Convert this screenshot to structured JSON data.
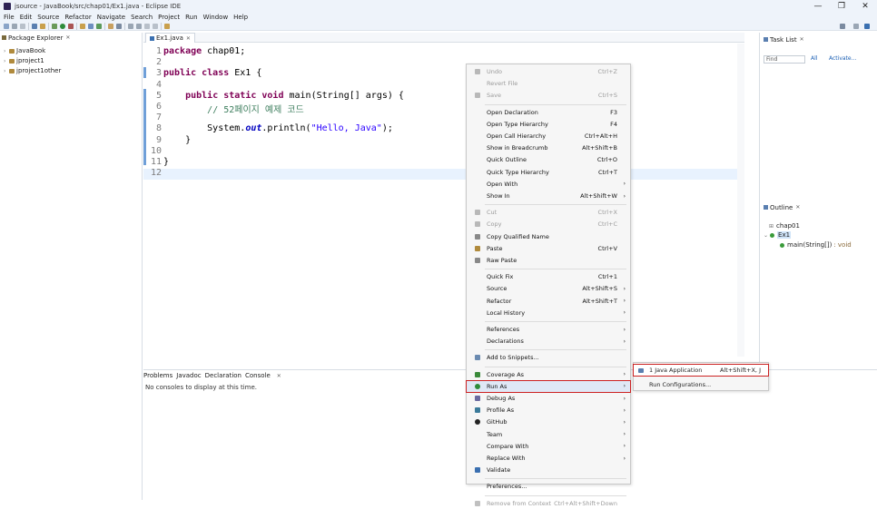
{
  "window": {
    "title": "jsource - JavaBook/src/chap01/Ex1.java - Eclipse IDE",
    "controls": [
      "—",
      "❐",
      "✕"
    ]
  },
  "menubar": [
    "File",
    "Edit",
    "Source",
    "Refactor",
    "Navigate",
    "Search",
    "Project",
    "Run",
    "Window",
    "Help"
  ],
  "package_explorer": {
    "tab": "Package Explorer",
    "projects": [
      "JavaBook",
      "jproject1",
      "jproject1other"
    ]
  },
  "editor": {
    "tab": "Ex1.java",
    "lines": [
      {
        "n": "1",
        "parts": [
          [
            "kw",
            "package"
          ],
          [
            "t",
            " chap01;"
          ]
        ]
      },
      {
        "n": "2",
        "parts": []
      },
      {
        "n": "3",
        "parts": [
          [
            "kw",
            "public class"
          ],
          [
            "t",
            " Ex1 {"
          ]
        ]
      },
      {
        "n": "4",
        "parts": []
      },
      {
        "n": "5",
        "parts": [
          [
            "t",
            "    "
          ],
          [
            "kw",
            "public static void"
          ],
          [
            "t",
            " main(String[] args) {"
          ]
        ]
      },
      {
        "n": "6",
        "parts": [
          [
            "t",
            "        "
          ],
          [
            "cmt",
            "// 52페이지 예제 코드"
          ]
        ]
      },
      {
        "n": "7",
        "parts": []
      },
      {
        "n": "8",
        "parts": [
          [
            "t",
            "        System."
          ],
          [
            "fld",
            "out"
          ],
          [
            "t",
            ".println("
          ],
          [
            "str",
            "\"Hello, Java\""
          ],
          [
            "t",
            ");"
          ]
        ]
      },
      {
        "n": "9",
        "parts": [
          [
            "t",
            "    }"
          ]
        ]
      },
      {
        "n": "10",
        "parts": []
      },
      {
        "n": "11",
        "parts": [
          [
            "t",
            "}"
          ]
        ]
      },
      {
        "n": "12",
        "parts": []
      }
    ]
  },
  "bottom_panel": {
    "tabs": [
      "Problems",
      "Javadoc",
      "Declaration",
      "Console"
    ],
    "message": "No consoles to display at this time."
  },
  "task_list": {
    "tab": "Task List",
    "find_placeholder": "Find",
    "all_label": "All",
    "activate_label": "Activate..."
  },
  "outline": {
    "tab": "Outline",
    "items": [
      "chap01",
      "Ex1",
      "main(String[])",
      ": void"
    ]
  },
  "context_menu": {
    "items": [
      {
        "label": "Undo",
        "accel": "Ctrl+Z",
        "disabled": true,
        "icon": "undo-icon"
      },
      {
        "label": "Revert File",
        "accel": "",
        "disabled": true
      },
      {
        "label": "Save",
        "accel": "Ctrl+S",
        "disabled": true,
        "icon": "save-icon"
      },
      {
        "sep": true
      },
      {
        "label": "Open Declaration",
        "accel": "F3"
      },
      {
        "label": "Open Type Hierarchy",
        "accel": "F4"
      },
      {
        "label": "Open Call Hierarchy",
        "accel": "Ctrl+Alt+H"
      },
      {
        "label": "Show in Breadcrumb",
        "accel": "Alt+Shift+B"
      },
      {
        "label": "Quick Outline",
        "accel": "Ctrl+O"
      },
      {
        "label": "Quick Type Hierarchy",
        "accel": "Ctrl+T"
      },
      {
        "label": "Open With",
        "accel": "",
        "submenu": true
      },
      {
        "label": "Show In",
        "accel": "Alt+Shift+W",
        "submenu": true
      },
      {
        "sep": true
      },
      {
        "label": "Cut",
        "accel": "Ctrl+X",
        "disabled": true,
        "icon": "cut-icon"
      },
      {
        "label": "Copy",
        "accel": "Ctrl+C",
        "disabled": true,
        "icon": "copy-icon"
      },
      {
        "label": "Copy Qualified Name",
        "accel": "",
        "icon": "copy-qualified-icon"
      },
      {
        "label": "Paste",
        "accel": "Ctrl+V",
        "icon": "paste-icon"
      },
      {
        "label": "Raw Paste",
        "accel": "",
        "icon": "raw-paste-icon"
      },
      {
        "sep": true
      },
      {
        "label": "Quick Fix",
        "accel": "Ctrl+1"
      },
      {
        "label": "Source",
        "accel": "Alt+Shift+S",
        "submenu": true
      },
      {
        "label": "Refactor",
        "accel": "Alt+Shift+T",
        "submenu": true
      },
      {
        "label": "Local History",
        "accel": "",
        "submenu": true
      },
      {
        "sep": true
      },
      {
        "label": "References",
        "accel": "",
        "submenu": true
      },
      {
        "label": "Declarations",
        "accel": "",
        "submenu": true
      },
      {
        "sep": true
      },
      {
        "label": "Add to Snippets...",
        "accel": "",
        "icon": "snippets-icon"
      },
      {
        "sep": true
      },
      {
        "label": "Coverage As",
        "accel": "",
        "submenu": true,
        "icon": "coverage-icon"
      },
      {
        "label": "Run As",
        "accel": "",
        "submenu": true,
        "icon": "run-icon",
        "selected": true
      },
      {
        "label": "Debug As",
        "accel": "",
        "submenu": true,
        "icon": "debug-icon"
      },
      {
        "label": "Profile As",
        "accel": "",
        "submenu": true,
        "icon": "profile-icon"
      },
      {
        "label": "GitHub",
        "accel": "",
        "submenu": true,
        "icon": "github-icon"
      },
      {
        "label": "Team",
        "accel": "",
        "submenu": true
      },
      {
        "label": "Compare With",
        "accel": "",
        "submenu": true
      },
      {
        "label": "Replace With",
        "accel": "",
        "submenu": true
      },
      {
        "label": "Validate",
        "accel": "",
        "icon": "validate-icon"
      },
      {
        "sep": true
      },
      {
        "label": "Preferences...",
        "accel": ""
      },
      {
        "sep": true
      },
      {
        "label": "Remove from Context",
        "accel": "Ctrl+Alt+Shift+Down",
        "disabled": true,
        "icon": "remove-context-icon"
      }
    ]
  },
  "run_as_submenu": {
    "items": [
      {
        "label": "1 Java Application",
        "accel": "Alt+Shift+X, J",
        "selected": true
      },
      {
        "label": "Run Configurations...",
        "accel": ""
      }
    ]
  }
}
